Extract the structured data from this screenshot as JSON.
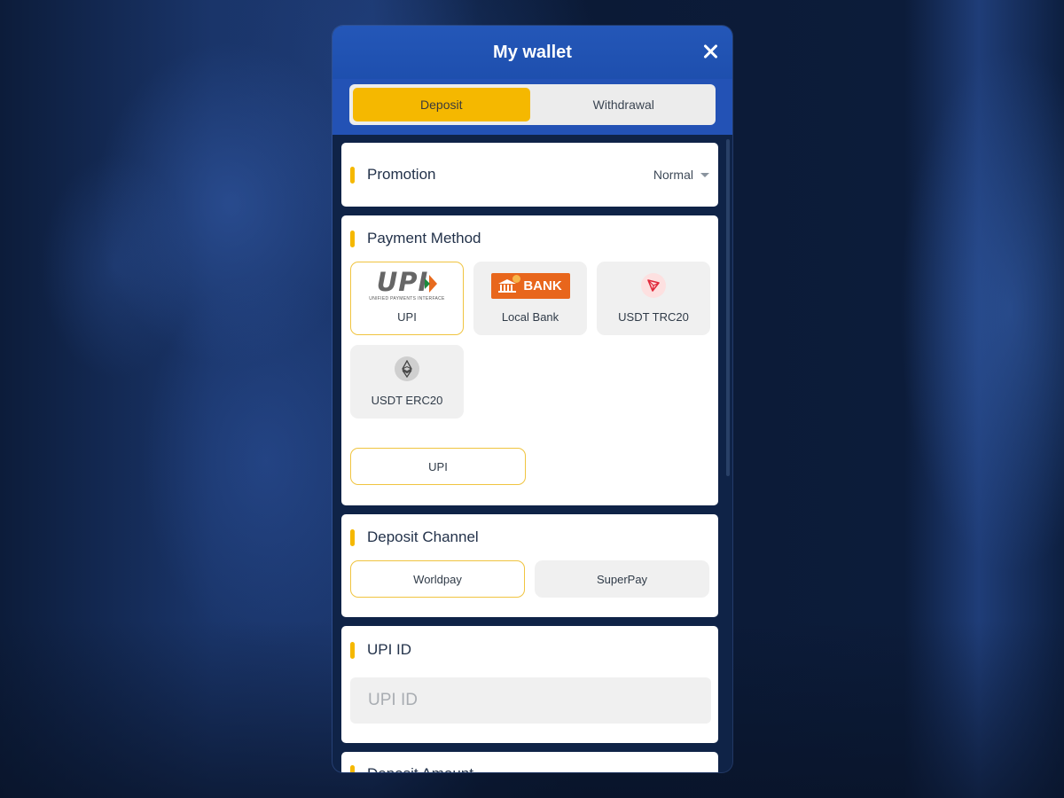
{
  "modal": {
    "title": "My wallet",
    "close_icon": "close-icon"
  },
  "tabs": [
    {
      "label": "Deposit",
      "active": true
    },
    {
      "label": "Withdrawal",
      "active": false
    }
  ],
  "promotion": {
    "title": "Promotion",
    "selected": "Normal",
    "dropdown_icon": "caret-down-icon"
  },
  "payment_method": {
    "title": "Payment Method",
    "methods": [
      {
        "label": "UPI",
        "icon": "upi-logo",
        "logo_text": "UPI",
        "logo_sub": "UNIFIED PAYMENTS INTERFACE",
        "active": true
      },
      {
        "label": "Local Bank",
        "icon": "bank-logo",
        "logo_text": "BANK",
        "active": false
      },
      {
        "label": "USDT TRC20",
        "icon": "tron-icon",
        "active": false
      },
      {
        "label": "USDT ERC20",
        "icon": "ethereum-icon",
        "active": false
      }
    ],
    "sub_option": "UPI"
  },
  "deposit_channel": {
    "title": "Deposit Channel",
    "channels": [
      {
        "label": "Worldpay",
        "active": true
      },
      {
        "label": "SuperPay",
        "active": false
      }
    ]
  },
  "upi_id": {
    "title": "UPI ID",
    "value": "",
    "placeholder": "UPI ID"
  },
  "deposit_amount": {
    "title": "Deposit Amount"
  },
  "colors": {
    "accent": "#f5b800",
    "header_blue": "#2352b5",
    "bank_orange": "#e8661c"
  }
}
